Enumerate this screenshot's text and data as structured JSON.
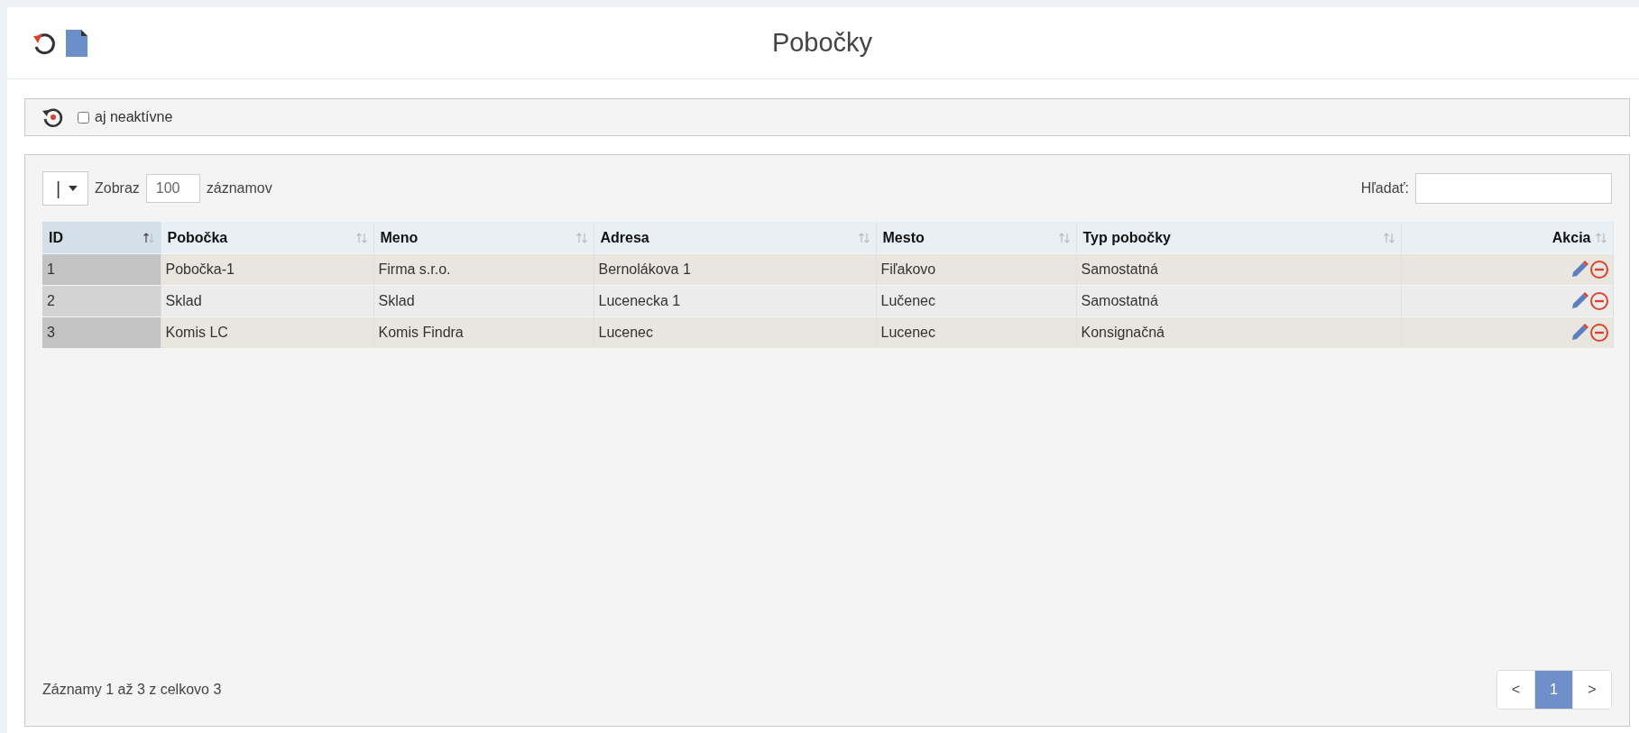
{
  "page": {
    "title": "Pobočky"
  },
  "filter_bar": {
    "checkbox": {
      "label": "aj neaktívne",
      "checked": false
    }
  },
  "table_controls": {
    "length_select": {
      "value": "|"
    },
    "length_prefix": "Zobraz",
    "length_input": {
      "value": "100"
    },
    "length_suffix": "záznamov",
    "search_label": "Hľadať:"
  },
  "table": {
    "columns": [
      {
        "label": "ID",
        "sorted": true
      },
      {
        "label": "Pobočka",
        "sorted": false
      },
      {
        "label": "Meno",
        "sorted": false
      },
      {
        "label": "Adresa",
        "sorted": false
      },
      {
        "label": "Mesto",
        "sorted": false
      },
      {
        "label": "Typ pobočky",
        "sorted": false
      },
      {
        "label": "Akcia",
        "sorted": false
      }
    ],
    "rows": [
      [
        "1",
        "Pobočka-1",
        "Firma s.r.o.",
        "Bernolákova 1",
        "Fiľakovo",
        "Samostatná"
      ],
      [
        "2",
        "Sklad",
        "Sklad",
        "Lucenecka 1",
        "Lučenec",
        "Samostatná"
      ],
      [
        "3",
        "Komis LC",
        "Komis Findra",
        "Lucenec",
        "Lucenec",
        "Konsignačná"
      ]
    ]
  },
  "footer": {
    "info": "Záznamy 1 až 3 z celkovo 3",
    "pagination": [
      {
        "label": "<",
        "selected": false
      },
      {
        "label": "1",
        "selected": true
      },
      {
        "label": ">",
        "selected": false
      }
    ]
  }
}
